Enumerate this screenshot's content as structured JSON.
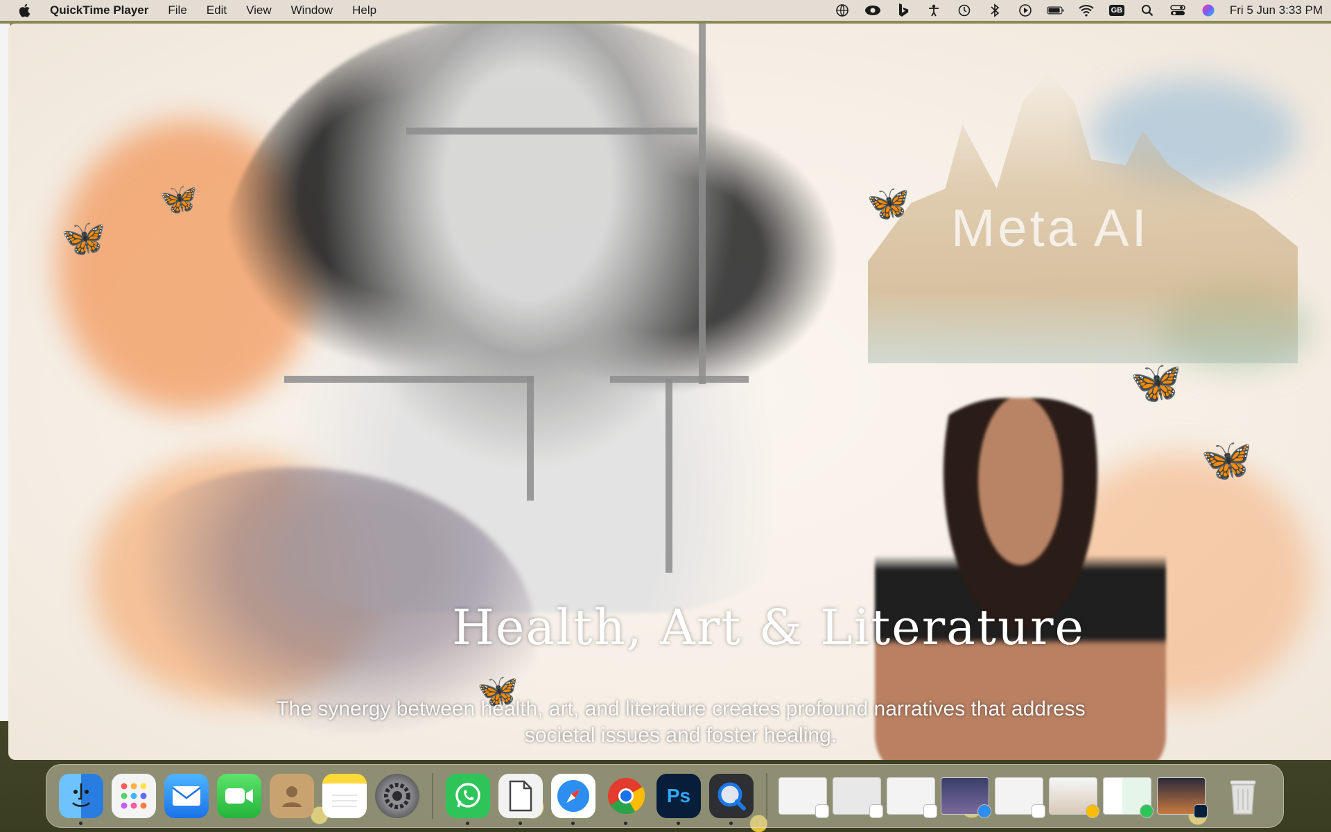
{
  "menubar": {
    "apple_icon": "apple-logo-icon",
    "app_name": "QuickTime Player",
    "menus": [
      "File",
      "Edit",
      "View",
      "Window",
      "Help"
    ],
    "status_icons": [
      "globe-icon",
      "eye-icon",
      "bing-icon",
      "accessibility-icon",
      "time-machine-icon",
      "bluetooth-icon",
      "play-icon",
      "battery-icon",
      "wifi-icon"
    ],
    "input_source": "GB",
    "clock": "Fri 5 Jun  3:33 PM"
  },
  "video": {
    "headline": "Health, Art & Literature",
    "subtitle": "The synergy between health, art, and literature creates profound narratives that address societal issues and foster healing.",
    "watermark": "Meta AI",
    "colors": {
      "splash_orange": "#f07828",
      "splash_blue": "#78aad2",
      "background": "#fbf6f0"
    }
  },
  "dock": {
    "apps": [
      {
        "name": "Finder",
        "icon": "finder-icon",
        "running": true
      },
      {
        "name": "Launchpad",
        "icon": "launchpad-icon",
        "running": false
      },
      {
        "name": "Mail",
        "icon": "mail-icon",
        "running": false
      },
      {
        "name": "FaceTime",
        "icon": "facetime-icon",
        "running": false
      },
      {
        "name": "Contacts",
        "icon": "contacts-icon",
        "running": false
      },
      {
        "name": "Notes",
        "icon": "notes-icon",
        "running": false
      },
      {
        "name": "System Settings",
        "icon": "settings-icon",
        "running": false
      },
      {
        "name": "WhatsApp",
        "icon": "whatsapp-icon",
        "running": true
      },
      {
        "name": "Preview",
        "icon": "preview-icon",
        "running": true
      },
      {
        "name": "Safari",
        "icon": "safari-icon",
        "running": true
      },
      {
        "name": "Chrome",
        "icon": "chrome-icon",
        "running": true
      },
      {
        "name": "Photoshop",
        "icon": "photoshop-icon",
        "running": true
      },
      {
        "name": "QuickTime Player",
        "icon": "quicktime-icon",
        "running": true
      }
    ],
    "minimized_windows": 8,
    "trash": "trash-icon"
  }
}
